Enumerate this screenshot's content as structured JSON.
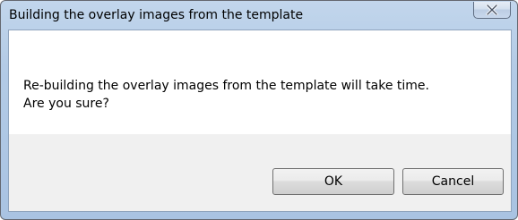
{
  "dialog": {
    "title": "Building the overlay images from the template",
    "close_icon": "close-icon",
    "message_line1": "Re-building the overlay images from the template will take time.",
    "message_line2": "Are you sure?",
    "ok_label": "OK",
    "cancel_label": "Cancel"
  }
}
